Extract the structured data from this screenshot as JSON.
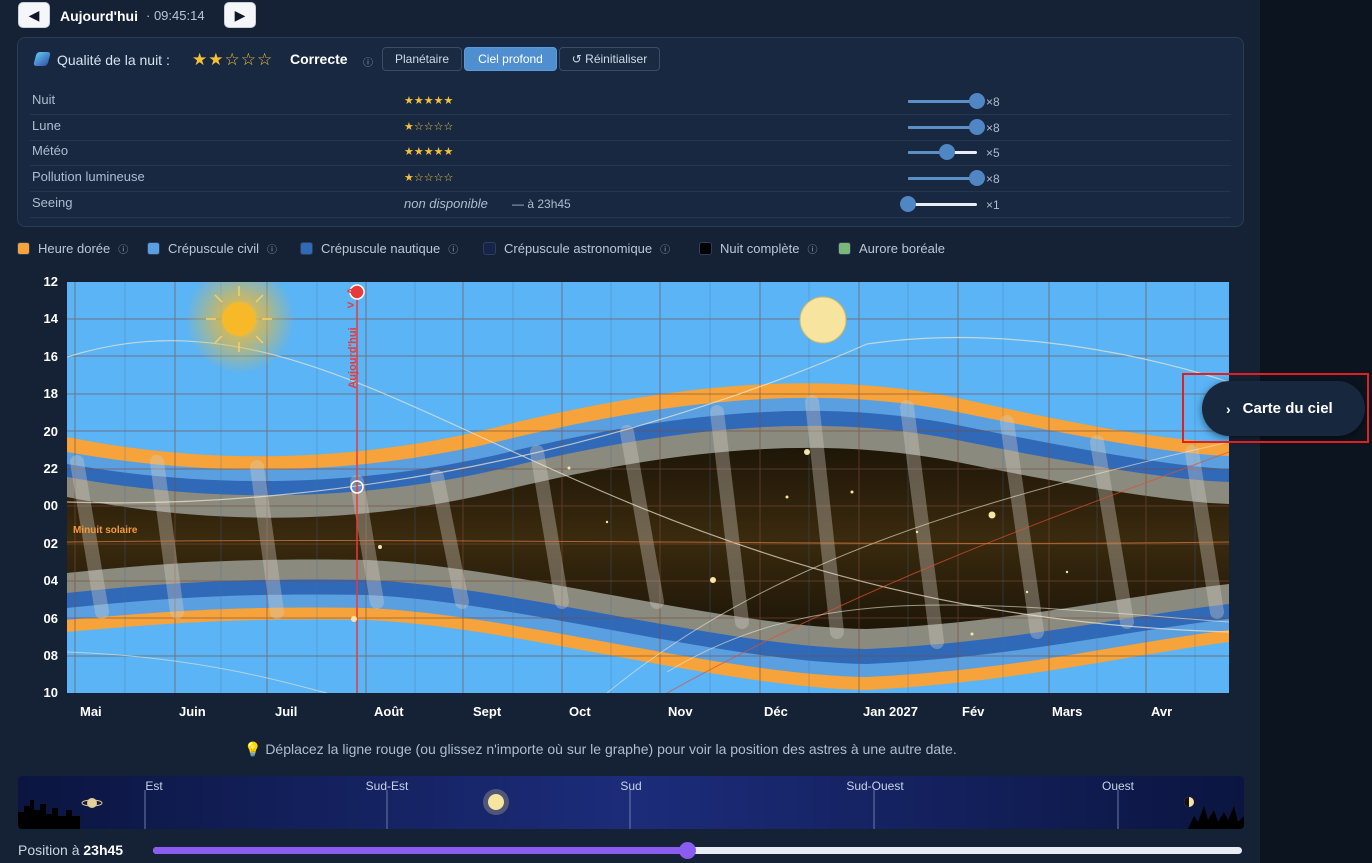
{
  "header": {
    "prev_label": "◀",
    "next_label": "▶",
    "title": "Aujourd'hui",
    "time": "· 09:45:14"
  },
  "quality": {
    "label": "Qualité de la nuit :",
    "stars": "★★☆☆☆",
    "rating": 2,
    "value": "Correcte",
    "info_icon": "ⓘ",
    "buttons": {
      "planetary": "Planétaire",
      "deep_sky": "Ciel profond",
      "reset": "↺ Réinitialiser"
    },
    "rows": [
      {
        "name": "Nuit",
        "stars": "★★★★★",
        "slider": 1.0,
        "mult": "×8"
      },
      {
        "name": "Lune",
        "stars": "★☆☆☆☆",
        "slider": 1.0,
        "mult": "×8"
      },
      {
        "name": "Météo",
        "stars": "★★★★★",
        "slider": 0.57,
        "mult": "×5"
      },
      {
        "name": "Pollution lumineuse",
        "stars": "★☆☆☆☆",
        "slider": 1.0,
        "mult": "×8"
      },
      {
        "name": "Seeing",
        "value": "non disponible",
        "at": "— à 23h45",
        "slider": 0.0,
        "mult": "×1"
      }
    ]
  },
  "legend": [
    {
      "label": "Heure dorée",
      "color": "#f5a33a",
      "info": "ⓘ"
    },
    {
      "label": "Crépuscule civil",
      "color": "#5a9fe0",
      "info": "ⓘ"
    },
    {
      "label": "Crépuscule nautique",
      "color": "#3069b8",
      "info": "ⓘ"
    },
    {
      "label": "Crépuscule astronomique",
      "color": "#16244a",
      "info": "ⓘ"
    },
    {
      "label": "Nuit complète",
      "color": "#000000",
      "info": "ⓘ"
    },
    {
      "label": "Aurore boréale",
      "color": "#7ab87a",
      "info": ""
    }
  ],
  "chart": {
    "y_ticks": [
      "12",
      "14",
      "16",
      "18",
      "20",
      "22",
      "00",
      "02",
      "04",
      "06",
      "08",
      "10"
    ],
    "x_ticks": [
      "Mai",
      "Juin",
      "Juil",
      "Août",
      "Sept",
      "Oct",
      "Nov",
      "Déc",
      "Jan 2027",
      "Fév",
      "Mars",
      "Avr"
    ],
    "today_label": "Aujourd'hui",
    "today_arrows": "< >",
    "midnight_label": "Minuit solaire"
  },
  "hint": "💡 Déplacez la ligne rouge (ou glissez n'importe où sur le graphe) pour voir la position des astres à une autre date.",
  "sky": {
    "directions": [
      "Est",
      "Sud-Est",
      "Sud",
      "Sud-Ouest",
      "Ouest"
    ]
  },
  "position": {
    "label": "Position à",
    "time": "23h45",
    "fraction": 0.49
  },
  "carte": {
    "chevron": "›",
    "label": "Carte du ciel"
  }
}
